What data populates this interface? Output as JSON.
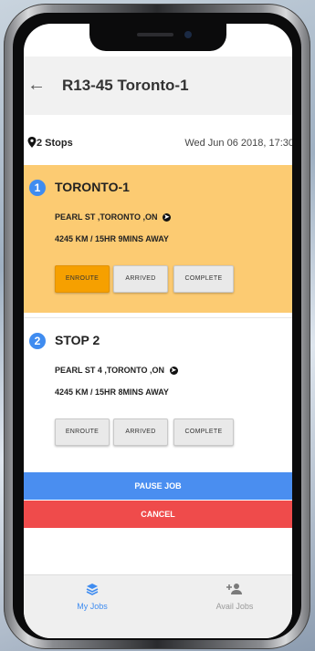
{
  "header": {
    "title": "R13-45 Toronto-1",
    "back_icon": "back-arrow-icon"
  },
  "summary": {
    "stops": "2 Stops",
    "datetime": "Wed Jun 06 2018, 17:30"
  },
  "stops": [
    {
      "number": "1",
      "name": "TORONTO-1",
      "address": "PEARL ST ,TORONTO ,ON",
      "distance": "4245 KM / 15HR 9MINS AWAY",
      "buttons": {
        "enroute": "ENROUTE",
        "arrived": "ARRIVED",
        "complete": "COMPLETE"
      },
      "active_button": "enroute"
    },
    {
      "number": "2",
      "name": "STOP 2",
      "address": "PEARL ST 4 ,TORONTO ,ON",
      "distance": "4245 KM / 15HR 8MINS AWAY",
      "buttons": {
        "enroute": "ENROUTE",
        "arrived": "ARRIVED",
        "complete": "COMPLETE"
      }
    }
  ],
  "actions": {
    "pause": "PAUSE JOB",
    "cancel": "CANCEL"
  },
  "bottom_nav": [
    {
      "label": "My Jobs",
      "icon": "stack-icon",
      "active": true
    },
    {
      "label": "Avail Jobs",
      "icon": "add-user-icon",
      "active": false
    }
  ],
  "colors": {
    "accent_blue": "#3f8cf0",
    "active_card": "#fccb72",
    "enroute_active": "#f6a000",
    "cancel_red": "#ef4b4b",
    "pause_blue": "#4a8ef0"
  }
}
